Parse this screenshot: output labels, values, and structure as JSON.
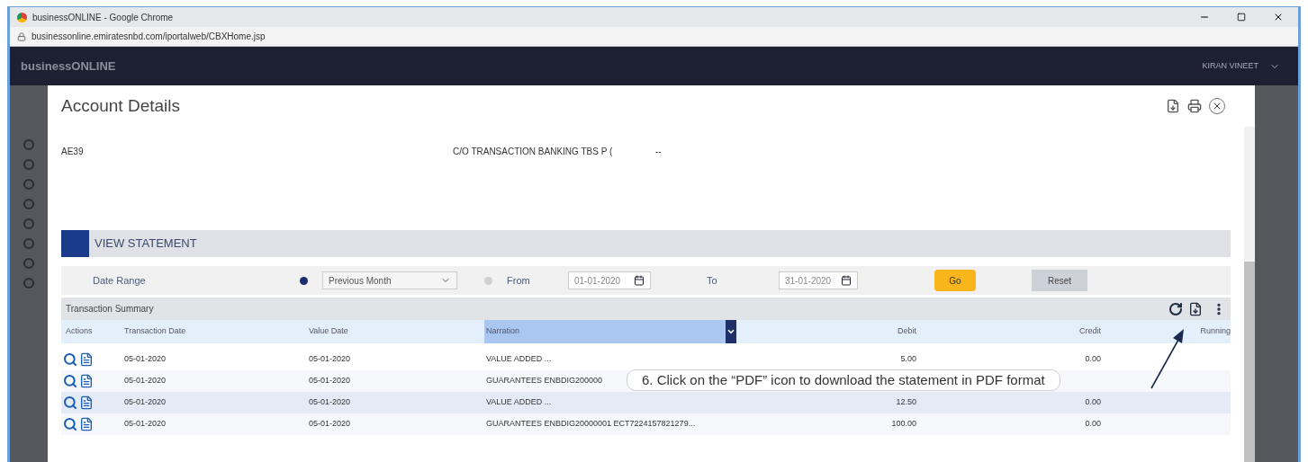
{
  "window": {
    "title": "businessONLINE - Google Chrome"
  },
  "address_bar": {
    "url": "businessonline.emiratesnbd.com/iportalweb/CBXHome.jsp"
  },
  "app_header": {
    "logo": "businessONLINE",
    "user": "KIRAN VINEET"
  },
  "modal": {
    "title": "Account Details",
    "account": {
      "iban": "AE39",
      "registered_address": "C/O TRANSACTION BANKING TBS P (",
      "mailing_address": "--"
    },
    "view_statement": {
      "title": "VIEW STATEMENT",
      "date_range": {
        "label": "Date Range",
        "options": [
          {
            "kind": "select",
            "selected": true,
            "value": "Previous Month"
          },
          {
            "kind": "from",
            "selected": false,
            "label": "From",
            "value": "01-01-2020"
          }
        ],
        "to_label": "To",
        "to_value": "31-01-2020"
      },
      "buttons": [
        {
          "kind": "primary",
          "label": "Go"
        },
        {
          "kind": "secondary",
          "label": "Reset"
        }
      ]
    },
    "table": {
      "title": "Transaction Summary",
      "columns": [
        "Actions",
        "Transaction Date",
        "Value Date",
        "Narration",
        "Debit",
        "Credit",
        "Running"
      ],
      "rows": [
        {
          "selected": false,
          "transaction_date": "05-01-2020",
          "value_date": "05-01-2020",
          "narration": "VALUE ADDED ...",
          "debit": "5.00",
          "credit": "0.00"
        },
        {
          "selected": false,
          "transaction_date": "05-01-2020",
          "value_date": "05-01-2020",
          "narration": "GUARANTEES ENBDIG200000",
          "debit": "",
          "credit": ""
        },
        {
          "selected": true,
          "transaction_date": "05-01-2020",
          "value_date": "05-01-2020",
          "narration": "VALUE ADDED ...",
          "debit": "12.50",
          "credit": "0.00"
        },
        {
          "selected": false,
          "transaction_date": "05-01-2020",
          "value_date": "05-01-2020",
          "narration": "GUARANTEES ENBDIG20000001 ECT7224157821279...",
          "debit": "100.00",
          "credit": "0.00"
        }
      ]
    }
  },
  "callout": {
    "text": "6.  Click on the “PDF” icon to download the statement in PDF format"
  }
}
